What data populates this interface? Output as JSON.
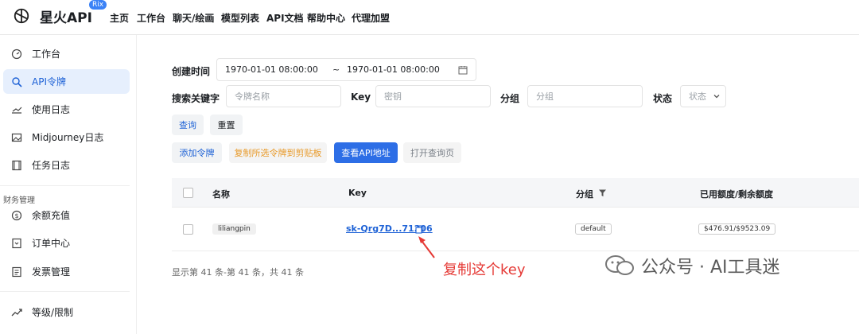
{
  "brand": {
    "name": "星火API",
    "badge": "Rix"
  },
  "nav": [
    "主页",
    "工作台",
    "聊天/绘画",
    "模型列表",
    "API文档",
    "帮助中心",
    "代理加盟"
  ],
  "sidebar": {
    "items": [
      {
        "label": "工作台",
        "icon": "dashboard-icon"
      },
      {
        "label": "API令牌",
        "icon": "key-icon",
        "active": true
      },
      {
        "label": "使用日志",
        "icon": "log-icon"
      },
      {
        "label": "Midjourney日志",
        "icon": "image-icon"
      },
      {
        "label": "任务日志",
        "icon": "film-icon"
      }
    ],
    "section_title": "财务管理",
    "finance_items": [
      {
        "label": "余额充值",
        "icon": "coin-icon"
      },
      {
        "label": "订单中心",
        "icon": "order-icon"
      },
      {
        "label": "发票管理",
        "icon": "invoice-icon"
      }
    ],
    "bottom_item": {
      "label": "等级/限制",
      "icon": "trend-icon"
    }
  },
  "filters": {
    "created_label": "创建时间",
    "start_time": "1970-01-01 08:00:00",
    "range_sep": "~",
    "end_time": "1970-01-01 08:00:00",
    "search_label": "搜索关键字",
    "token_name_placeholder": "令牌名称",
    "key_label": "Key",
    "key_placeholder": "密钥",
    "group_label": "分组",
    "group_placeholder": "分组",
    "status_label": "状态",
    "status_value": "状态",
    "query_button": "查询",
    "reset_button": "重置"
  },
  "actions": {
    "add": "添加令牌",
    "copy_selected": "复制所选令牌到剪贴板",
    "view_api": "查看API地址",
    "open_query": "打开查询页"
  },
  "table": {
    "headers": [
      "名称",
      "Key",
      "分组",
      "已用额度/剩余额度"
    ],
    "rows": [
      {
        "name": "liliangpin",
        "key": "sk-Qrg7D...71206",
        "group": "default",
        "quota": "$476.91/$9523.09"
      }
    ]
  },
  "pagination": "显示第 41 条-第 41 条，共 41 条",
  "annotation": "复制这个key",
  "watermark": "公众号 · AI工具迷",
  "colors": {
    "accent": "#2d6ee6",
    "annotation": "#e53935"
  }
}
